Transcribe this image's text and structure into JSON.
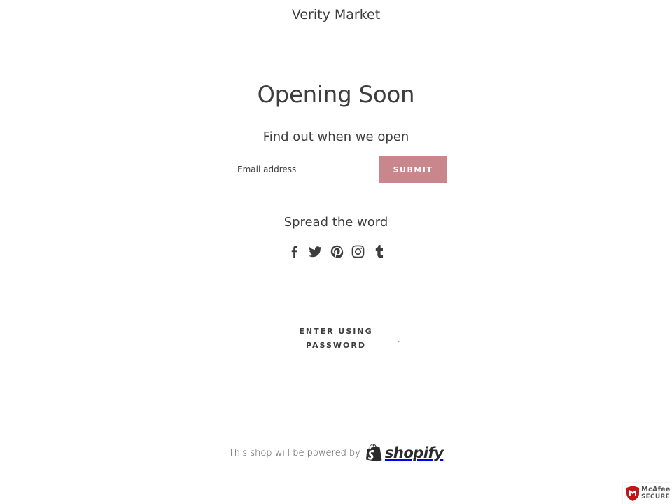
{
  "header": {
    "store_name": "Verity Market"
  },
  "main": {
    "headline": "Opening Soon",
    "subhead": "Find out when we open",
    "form": {
      "email_placeholder": "Email address",
      "submit_label": "SUBMIT"
    },
    "social": {
      "title": "Spread the word",
      "icons": [
        "facebook-icon",
        "twitter-icon",
        "pinterest-icon",
        "instagram-icon",
        "tumblr-icon"
      ]
    },
    "password_link": {
      "line1": "ENTER USING",
      "line2": "PASSWORD"
    }
  },
  "footer": {
    "powered_text": "This shop will be powered by",
    "shopify_word": "shopify"
  },
  "badge": {
    "brand": "McAfee",
    "secure": "SECURE"
  },
  "colors": {
    "accent": "#c9868d",
    "text": "#3d3d3d",
    "mcafee_red": "#c01818"
  }
}
